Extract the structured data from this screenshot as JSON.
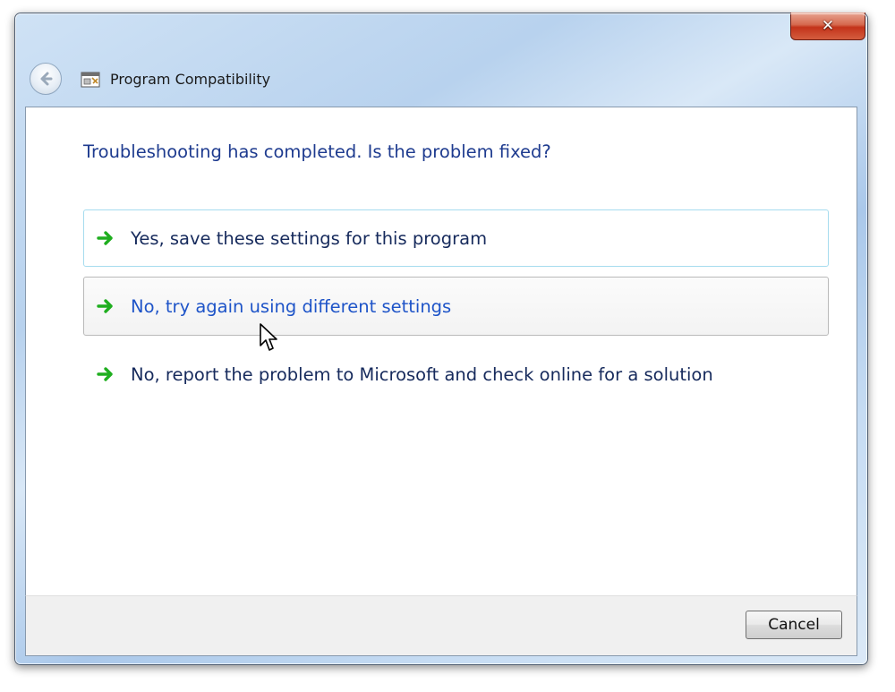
{
  "window": {
    "title": "Program Compatibility",
    "close_glyph": "✕"
  },
  "icons": {
    "back": "back-arrow-icon",
    "app": "program-compatibility-icon",
    "close": "close-icon",
    "option": "green-arrow-icon",
    "cursor": "mouse-pointer-icon"
  },
  "content": {
    "heading": "Troubleshooting has completed.  Is the problem fixed?",
    "options": [
      {
        "label": "Yes, save these settings for this program"
      },
      {
        "label": "No, try again using different settings"
      },
      {
        "label": "No, report the problem to Microsoft and check online for a solution"
      }
    ]
  },
  "footer": {
    "cancel_label": "Cancel"
  },
  "colors": {
    "heading": "#1e3b8f",
    "link_hover": "#1e54c8",
    "arrow_green": "#1fae1f",
    "close_red": "#c3331a"
  }
}
